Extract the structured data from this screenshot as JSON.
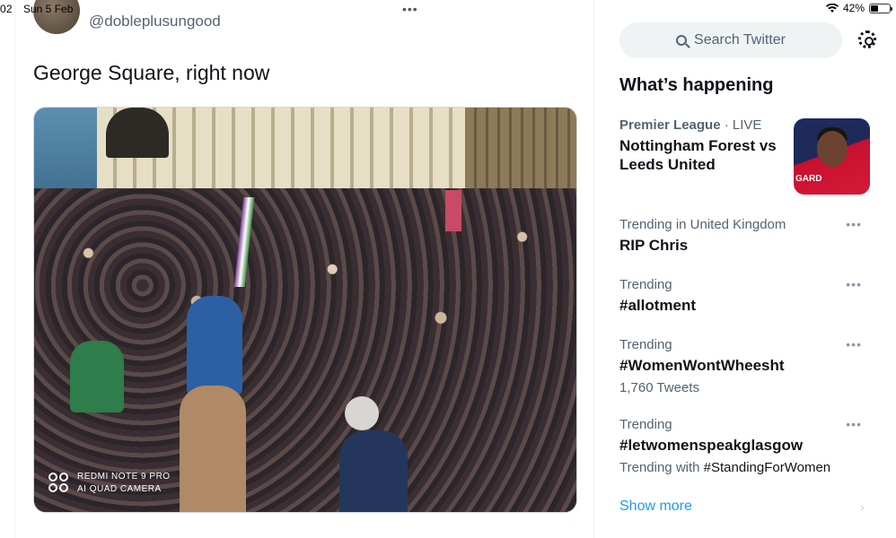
{
  "status_bar": {
    "time": "02",
    "date": "Sun 5 Feb",
    "battery": "42%",
    "battery_level": 0.42
  },
  "tweet": {
    "handle": "@dobleplusungood",
    "text": "George Square, right now",
    "photo_watermark": {
      "line1": "REDMI NOTE 9 PRO",
      "line2": "AI QUAD CAMERA"
    }
  },
  "sidebar": {
    "search_placeholder": "Search Twitter",
    "section_title": "What’s happening",
    "news": {
      "category": "Premier League",
      "separator": " · ",
      "live": "LIVE",
      "title": "Nottingham Forest vs Leeds United",
      "thumb_text": "GARD"
    },
    "trends": [
      {
        "meta": "Trending in United Kingdom",
        "name": "RIP Chris",
        "sub": ""
      },
      {
        "meta": "Trending",
        "name": "#allotment",
        "sub": ""
      },
      {
        "meta": "Trending",
        "name": "#WomenWontWheesht",
        "sub": "1,760 Tweets"
      },
      {
        "meta": "Trending",
        "name": "#letwomenspeakglasgow",
        "sub_prefix": "Trending with ",
        "sub_tag": "#StandingForWomen"
      }
    ],
    "show_more": "Show more"
  },
  "colors": {
    "accent": "#1d9bf0",
    "secondary_text": "#536471",
    "primary_text": "#0f1419"
  }
}
